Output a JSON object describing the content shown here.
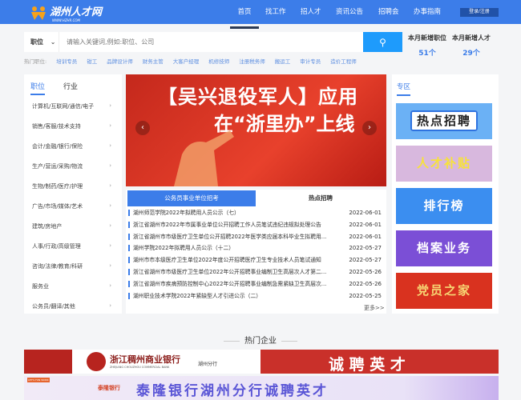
{
  "header": {
    "logo_text": "湖州人才网",
    "logo_sub": "WWW.HZHR.COM",
    "nav": [
      "首页",
      "找工作",
      "招人才",
      "资讯公告",
      "招聘会",
      "办事指南"
    ],
    "login": "登录/注册"
  },
  "search": {
    "type": "职位",
    "placeholder": "请输入关键词,例如:职位、公司"
  },
  "stats": [
    {
      "label": "本月新增职位",
      "value": "51个"
    },
    {
      "label": "本月新增人才",
      "value": "29个"
    }
  ],
  "hot": {
    "label": "热门职位:",
    "items": [
      "培训专员",
      "钳工",
      "品牌设计师",
      "财务主管",
      "大客户经理",
      "机修技师",
      "注册税务师",
      "搬运工",
      "审计专员",
      "造价工程师"
    ]
  },
  "left": {
    "tabs": [
      "职位",
      "行业"
    ],
    "categories": [
      "计算机/互联网/通信/电子",
      "销售/客服/技术支持",
      "会计/金融/银行/保险",
      "生产/营运/采购/物流",
      "生物/制药/医疗/护理",
      "广告/市场/媒体/艺术",
      "建筑/房地产",
      "人事/行政/高级管理",
      "咨询/法律/教育/科研",
      "服务业",
      "公务员/翻译/其他"
    ]
  },
  "banner": {
    "line1": "【吴兴退役军人】应用",
    "line2": "在“浙里办”上线"
  },
  "news": {
    "tabs": [
      "公务员事业单位招考",
      "热点招聘"
    ],
    "items": [
      {
        "title": "湖州师范学院2022年拟聘用人员公示（七）",
        "date": "2022-06-01"
      },
      {
        "title": "浙江省湖州市2022年市属事业单位公开招聘工作人员笔试违纪违规拟处理公告",
        "date": "2022-06-01"
      },
      {
        "title": "浙江省湖州市市级医疗卫生单位公开招聘2022年医学类应届本科毕业生拟聘用...",
        "date": "2022-06-01"
      },
      {
        "title": "湖州学院2022年拟聘用人员公示（十二）",
        "date": "2022-05-27"
      },
      {
        "title": "湖州市市本级医疗卫生单位2022年度公开招聘医疗卫生专业技术人员笔试通知",
        "date": "2022-05-27"
      },
      {
        "title": "浙江省湖州市市级医疗卫生单位2022年公开招聘事业编制卫生高层次人才第二...",
        "date": "2022-05-26"
      },
      {
        "title": "浙江省湖州市疾病预防控制中心2022年公开招聘事业编制急需紧缺卫生高层次...",
        "date": "2022-05-26"
      },
      {
        "title": "湖州职业技术学院2022年紧缺型人才引进公示（二）",
        "date": "2022-05-25"
      }
    ],
    "more": "更多>>"
  },
  "zone": {
    "title": "专区",
    "items": [
      "热点招聘",
      "人才补贴",
      "排行榜",
      "档案业务",
      "党员之家"
    ]
  },
  "companies": {
    "title": "热门企业",
    "banners": [
      {
        "name": "浙江稠州商业银行",
        "en": "ZHEJIANG CHOUZHOU COMMERCIAL BANK",
        "branch": "湖州分行",
        "slogan": "诚 聘 英 才"
      },
      {
        "tag": "LET'S FUN WORK",
        "name": "泰隆银行",
        "slogan": "泰隆银行湖州分行诚聘英才"
      }
    ]
  }
}
